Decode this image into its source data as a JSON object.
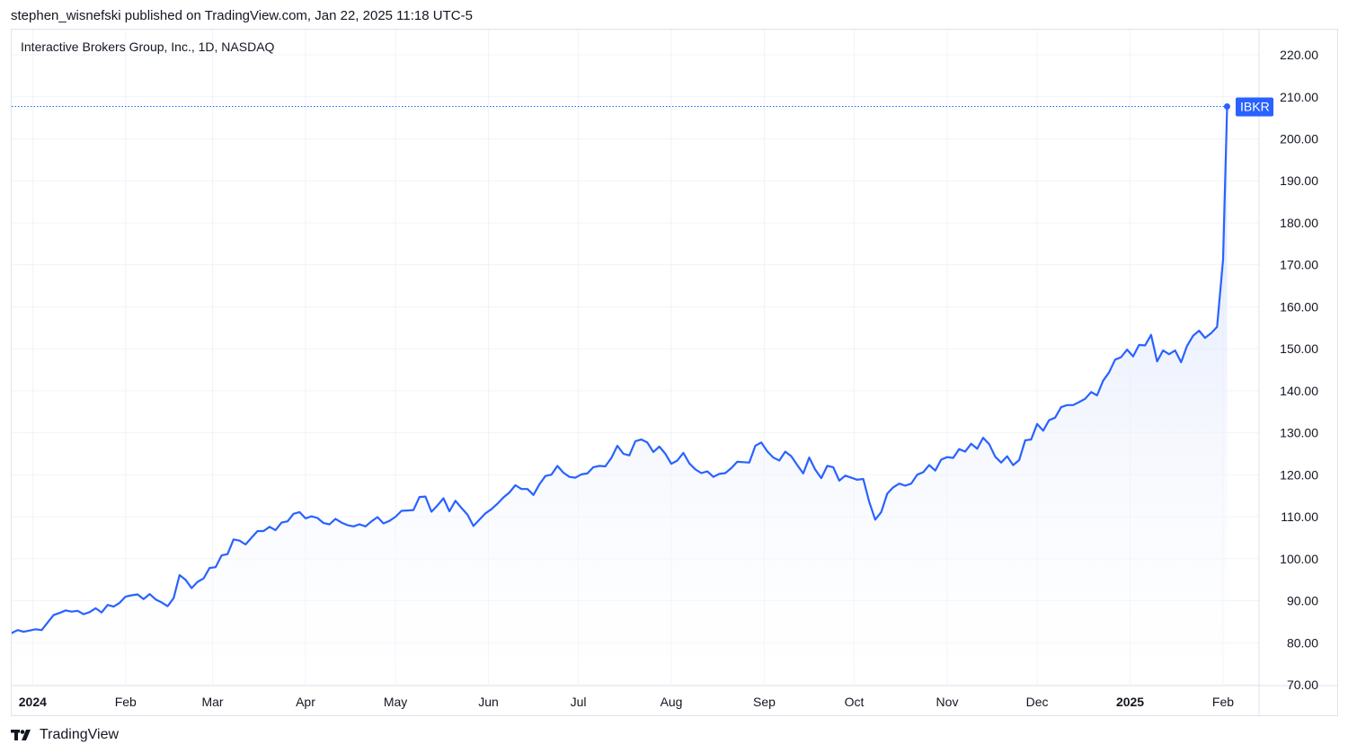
{
  "header": {
    "published_text": "stephen_wisnefski published on TradingView.com, Jan 22, 2025 11:18 UTC-5"
  },
  "footer": {
    "brand": "TradingView",
    "logo_icon": "tradingview-logo-icon"
  },
  "colors": {
    "line": "#2962ff",
    "grid": "#f0f3fa",
    "border": "#e0e3eb",
    "text": "#131722",
    "fill_top": "#dbe4fd"
  },
  "chart_data": {
    "type": "area",
    "title": "Interactive Brokers Group, Inc., 1D, NASDAQ",
    "symbol": "IBKR",
    "last_value": 207.7,
    "ylim": [
      70,
      223
    ],
    "y_ticks": [
      "220.00",
      "210.00",
      "200.00",
      "190.00",
      "180.00",
      "170.00",
      "160.00",
      "150.00",
      "140.00",
      "130.00",
      "120.00",
      "110.00",
      "100.00",
      "90.00",
      "80.00",
      "70.00"
    ],
    "x_ticks": [
      {
        "label": "2024",
        "bold": true
      },
      {
        "label": "Feb",
        "bold": false
      },
      {
        "label": "Mar",
        "bold": false
      },
      {
        "label": "Apr",
        "bold": false
      },
      {
        "label": "May",
        "bold": false
      },
      {
        "label": "Jun",
        "bold": false
      },
      {
        "label": "Jul",
        "bold": false
      },
      {
        "label": "Aug",
        "bold": false
      },
      {
        "label": "Sep",
        "bold": false
      },
      {
        "label": "Oct",
        "bold": false
      },
      {
        "label": "Nov",
        "bold": false
      },
      {
        "label": "Dec",
        "bold": false
      },
      {
        "label": "2025",
        "bold": true
      },
      {
        "label": "Feb",
        "bold": false
      }
    ],
    "x_tick_dates": [
      "2024-01-01",
      "2024-02-01",
      "2024-03-01",
      "2024-04-01",
      "2024-05-01",
      "2024-06-01",
      "2024-07-01",
      "2024-08-01",
      "2024-09-01",
      "2024-10-01",
      "2024-11-01",
      "2024-12-01",
      "2025-01-01",
      "2025-02-01"
    ],
    "x_range": [
      "2023-12-25",
      "2025-02-13"
    ],
    "grid": true,
    "series": [
      {
        "points": [
          [
            "2023-12-25",
            82.3
          ],
          [
            "2023-12-27",
            83.0
          ],
          [
            "2023-12-29",
            82.6
          ],
          [
            "2024-01-02",
            83.2
          ],
          [
            "2024-01-04",
            83.0
          ],
          [
            "2024-01-06",
            84.8
          ],
          [
            "2024-01-08",
            86.6
          ],
          [
            "2024-01-10",
            87.1
          ],
          [
            "2024-01-12",
            87.7
          ],
          [
            "2024-01-14",
            87.4
          ],
          [
            "2024-01-16",
            87.6
          ],
          [
            "2024-01-18",
            86.8
          ],
          [
            "2024-01-20",
            87.3
          ],
          [
            "2024-01-22",
            88.2
          ],
          [
            "2024-01-24",
            87.2
          ],
          [
            "2024-01-26",
            89.0
          ],
          [
            "2024-01-28",
            88.6
          ],
          [
            "2024-01-30",
            89.5
          ],
          [
            "2024-02-01",
            91.0
          ],
          [
            "2024-02-03",
            91.3
          ],
          [
            "2024-02-05",
            91.5
          ],
          [
            "2024-02-07",
            90.4
          ],
          [
            "2024-02-09",
            91.6
          ],
          [
            "2024-02-11",
            90.3
          ],
          [
            "2024-02-13",
            89.6
          ],
          [
            "2024-02-15",
            88.7
          ],
          [
            "2024-02-17",
            90.6
          ],
          [
            "2024-02-19",
            96.1
          ],
          [
            "2024-02-21",
            95.0
          ],
          [
            "2024-02-23",
            93.0
          ],
          [
            "2024-02-25",
            94.5
          ],
          [
            "2024-02-27",
            95.3
          ],
          [
            "2024-02-29",
            97.8
          ],
          [
            "2024-03-02",
            98.0
          ],
          [
            "2024-03-04",
            100.8
          ],
          [
            "2024-03-06",
            101.1
          ],
          [
            "2024-03-08",
            104.6
          ],
          [
            "2024-03-10",
            104.3
          ],
          [
            "2024-03-12",
            103.4
          ],
          [
            "2024-03-14",
            105.0
          ],
          [
            "2024-03-16",
            106.6
          ],
          [
            "2024-03-18",
            106.6
          ],
          [
            "2024-03-20",
            107.6
          ],
          [
            "2024-03-22",
            106.8
          ],
          [
            "2024-03-24",
            108.6
          ],
          [
            "2024-03-26",
            108.9
          ],
          [
            "2024-03-28",
            110.7
          ],
          [
            "2024-03-30",
            111.1
          ],
          [
            "2024-04-01",
            109.6
          ],
          [
            "2024-04-03",
            110.1
          ],
          [
            "2024-04-05",
            109.7
          ],
          [
            "2024-04-07",
            108.5
          ],
          [
            "2024-04-09",
            108.2
          ],
          [
            "2024-04-11",
            109.5
          ],
          [
            "2024-04-13",
            108.6
          ],
          [
            "2024-04-15",
            108.0
          ],
          [
            "2024-04-17",
            107.7
          ],
          [
            "2024-04-19",
            108.2
          ],
          [
            "2024-04-21",
            107.7
          ],
          [
            "2024-04-23",
            108.9
          ],
          [
            "2024-04-25",
            109.9
          ],
          [
            "2024-04-27",
            108.4
          ],
          [
            "2024-04-29",
            109.0
          ],
          [
            "2024-05-01",
            110.0
          ],
          [
            "2024-05-03",
            111.4
          ],
          [
            "2024-05-05",
            111.5
          ],
          [
            "2024-05-07",
            111.6
          ],
          [
            "2024-05-09",
            114.7
          ],
          [
            "2024-05-11",
            114.8
          ],
          [
            "2024-05-13",
            111.2
          ],
          [
            "2024-05-15",
            112.7
          ],
          [
            "2024-05-17",
            114.4
          ],
          [
            "2024-05-19",
            111.3
          ],
          [
            "2024-05-21",
            113.8
          ],
          [
            "2024-05-23",
            112.1
          ],
          [
            "2024-05-25",
            110.5
          ],
          [
            "2024-05-27",
            107.8
          ],
          [
            "2024-05-29",
            109.3
          ],
          [
            "2024-05-31",
            110.8
          ],
          [
            "2024-06-02",
            111.8
          ],
          [
            "2024-06-04",
            113.1
          ],
          [
            "2024-06-06",
            114.6
          ],
          [
            "2024-06-08",
            115.8
          ],
          [
            "2024-06-10",
            117.5
          ],
          [
            "2024-06-12",
            116.6
          ],
          [
            "2024-06-14",
            116.6
          ],
          [
            "2024-06-16",
            115.2
          ],
          [
            "2024-06-18",
            117.7
          ],
          [
            "2024-06-20",
            119.7
          ],
          [
            "2024-06-22",
            120.0
          ],
          [
            "2024-06-24",
            122.1
          ],
          [
            "2024-06-26",
            120.5
          ],
          [
            "2024-06-28",
            119.5
          ],
          [
            "2024-06-30",
            119.3
          ],
          [
            "2024-07-02",
            120.1
          ],
          [
            "2024-07-04",
            120.3
          ],
          [
            "2024-07-06",
            121.8
          ],
          [
            "2024-07-08",
            122.1
          ],
          [
            "2024-07-10",
            122.0
          ],
          [
            "2024-07-12",
            124.0
          ],
          [
            "2024-07-14",
            126.9
          ],
          [
            "2024-07-16",
            125.0
          ],
          [
            "2024-07-18",
            124.6
          ],
          [
            "2024-07-20",
            128.0
          ],
          [
            "2024-07-22",
            128.4
          ],
          [
            "2024-07-24",
            127.7
          ],
          [
            "2024-07-26",
            125.4
          ],
          [
            "2024-07-28",
            126.7
          ],
          [
            "2024-07-30",
            125.0
          ],
          [
            "2024-08-01",
            122.6
          ],
          [
            "2024-08-03",
            123.4
          ],
          [
            "2024-08-05",
            125.2
          ],
          [
            "2024-08-07",
            122.7
          ],
          [
            "2024-08-09",
            121.3
          ],
          [
            "2024-08-11",
            120.4
          ],
          [
            "2024-08-13",
            120.8
          ],
          [
            "2024-08-15",
            119.5
          ],
          [
            "2024-08-17",
            120.2
          ],
          [
            "2024-08-19",
            120.4
          ],
          [
            "2024-08-21",
            121.6
          ],
          [
            "2024-08-23",
            123.1
          ],
          [
            "2024-08-25",
            123.0
          ],
          [
            "2024-08-27",
            122.9
          ],
          [
            "2024-08-29",
            126.9
          ],
          [
            "2024-08-31",
            127.7
          ],
          [
            "2024-09-02",
            125.6
          ],
          [
            "2024-09-04",
            124.1
          ],
          [
            "2024-09-06",
            123.4
          ],
          [
            "2024-09-08",
            125.5
          ],
          [
            "2024-09-10",
            124.4
          ],
          [
            "2024-09-12",
            122.3
          ],
          [
            "2024-09-14",
            120.3
          ],
          [
            "2024-09-16",
            124.1
          ],
          [
            "2024-09-18",
            121.2
          ],
          [
            "2024-09-20",
            119.2
          ],
          [
            "2024-09-22",
            122.1
          ],
          [
            "2024-09-24",
            121.8
          ],
          [
            "2024-09-26",
            118.6
          ],
          [
            "2024-09-28",
            119.8
          ],
          [
            "2024-09-30",
            119.3
          ],
          [
            "2024-10-02",
            118.8
          ],
          [
            "2024-10-04",
            119.0
          ],
          [
            "2024-10-06",
            113.5
          ],
          [
            "2024-10-08",
            109.3
          ],
          [
            "2024-10-10",
            111.1
          ],
          [
            "2024-10-12",
            115.5
          ],
          [
            "2024-10-14",
            117.0
          ],
          [
            "2024-10-16",
            117.9
          ],
          [
            "2024-10-18",
            117.4
          ],
          [
            "2024-10-20",
            117.9
          ],
          [
            "2024-10-22",
            120.0
          ],
          [
            "2024-10-24",
            120.6
          ],
          [
            "2024-10-26",
            122.3
          ],
          [
            "2024-10-28",
            121.0
          ],
          [
            "2024-10-30",
            123.6
          ],
          [
            "2024-11-01",
            124.2
          ],
          [
            "2024-11-03",
            124.0
          ],
          [
            "2024-11-05",
            126.1
          ],
          [
            "2024-11-07",
            125.5
          ],
          [
            "2024-11-09",
            127.4
          ],
          [
            "2024-11-11",
            126.2
          ],
          [
            "2024-11-13",
            128.8
          ],
          [
            "2024-11-15",
            127.3
          ],
          [
            "2024-11-17",
            124.3
          ],
          [
            "2024-11-19",
            122.9
          ],
          [
            "2024-11-21",
            124.4
          ],
          [
            "2024-11-23",
            122.3
          ],
          [
            "2024-11-25",
            123.5
          ],
          [
            "2024-11-27",
            128.2
          ],
          [
            "2024-11-29",
            128.4
          ],
          [
            "2024-12-01",
            132.1
          ],
          [
            "2024-12-03",
            130.5
          ],
          [
            "2024-12-05",
            133.0
          ],
          [
            "2024-12-07",
            133.6
          ],
          [
            "2024-12-09",
            136.1
          ],
          [
            "2024-12-11",
            136.6
          ],
          [
            "2024-12-13",
            136.6
          ],
          [
            "2024-12-15",
            137.3
          ],
          [
            "2024-12-17",
            138.1
          ],
          [
            "2024-12-19",
            139.7
          ],
          [
            "2024-12-21",
            138.9
          ],
          [
            "2024-12-23",
            142.4
          ],
          [
            "2024-12-25",
            144.4
          ],
          [
            "2024-12-27",
            147.4
          ],
          [
            "2024-12-29",
            148.0
          ],
          [
            "2024-12-31",
            149.8
          ],
          [
            "2025-01-02",
            148.2
          ],
          [
            "2025-01-04",
            150.9
          ],
          [
            "2025-01-06",
            150.8
          ],
          [
            "2025-01-08",
            153.3
          ],
          [
            "2025-01-10",
            147.0
          ],
          [
            "2025-01-12",
            149.6
          ],
          [
            "2025-01-14",
            148.7
          ],
          [
            "2025-01-16",
            149.6
          ],
          [
            "2025-01-18",
            146.8
          ],
          [
            "2025-01-20",
            150.7
          ],
          [
            "2025-01-22",
            153.1
          ],
          [
            "2025-01-24",
            154.3
          ],
          [
            "2025-01-26",
            152.6
          ],
          [
            "2025-01-28",
            153.7
          ],
          [
            "2025-01-30",
            155.2
          ],
          [
            "2025-02-01",
            171.3
          ]
        ]
      }
    ]
  }
}
